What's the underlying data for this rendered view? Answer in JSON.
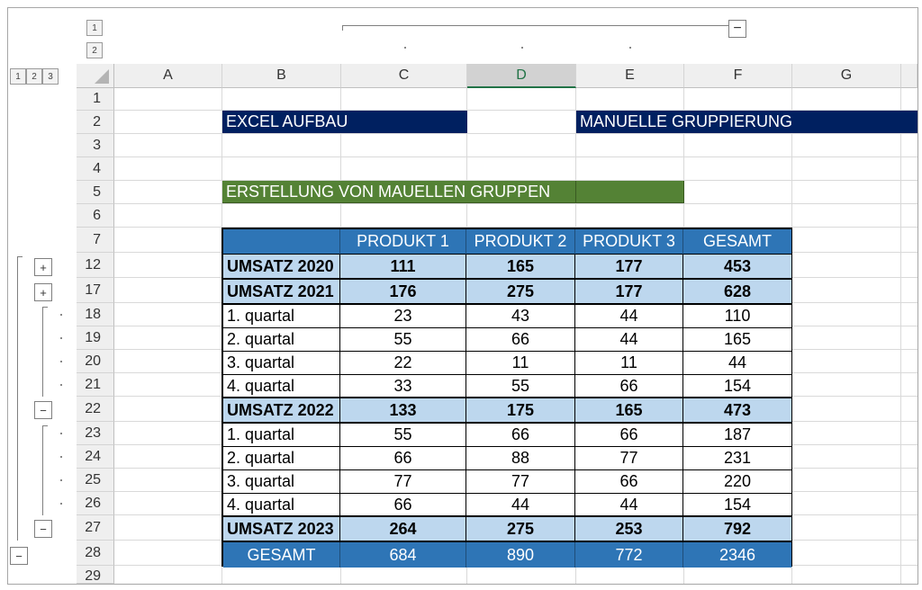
{
  "outline": {
    "col_levels": [
      "1",
      "2"
    ],
    "row_levels": [
      "1",
      "2",
      "3"
    ],
    "buttons": {
      "top_collapse": "−",
      "row12": "+",
      "row17": "+",
      "row22": "−",
      "row27": "−",
      "row28": "−"
    }
  },
  "columns": [
    "A",
    "B",
    "C",
    "D",
    "E",
    "F",
    "G"
  ],
  "selected_column": "D",
  "rows": [
    "1",
    "2",
    "3",
    "4",
    "5",
    "6",
    "7",
    "12",
    "17",
    "18",
    "19",
    "20",
    "21",
    "22",
    "23",
    "24",
    "25",
    "26",
    "27",
    "28",
    "29"
  ],
  "labels": {
    "excel_aufbau": "EXCEL AUFBAU",
    "manuelle": "MANUELLE GRUPPIERUNG",
    "erstellung": "ERSTELLUNG VON MAUELLEN GRUPPEN"
  },
  "table": {
    "headers": [
      "",
      "PRODUKT 1",
      "PRODUKT 2",
      "PRODUKT 3",
      "GESAMT"
    ],
    "rows": [
      {
        "label": "UMSATZ 2020",
        "values": [
          "111",
          "165",
          "177",
          "453"
        ]
      },
      {
        "label": "UMSATZ 2021",
        "values": [
          "176",
          "275",
          "177",
          "628"
        ]
      },
      {
        "label": "1. quartal",
        "values": [
          "23",
          "43",
          "44",
          "110"
        ]
      },
      {
        "label": "2. quartal",
        "values": [
          "55",
          "66",
          "44",
          "165"
        ]
      },
      {
        "label": "3. quartal",
        "values": [
          "22",
          "11",
          "11",
          "44"
        ]
      },
      {
        "label": "4. quartal",
        "values": [
          "33",
          "55",
          "66",
          "154"
        ]
      },
      {
        "label": "UMSATZ 2022",
        "values": [
          "133",
          "175",
          "165",
          "473"
        ]
      },
      {
        "label": "1. quartal",
        "values": [
          "55",
          "66",
          "66",
          "187"
        ]
      },
      {
        "label": "2. quartal",
        "values": [
          "66",
          "88",
          "77",
          "231"
        ]
      },
      {
        "label": "3. quartal",
        "values": [
          "77",
          "77",
          "66",
          "220"
        ]
      },
      {
        "label": "4. quartal",
        "values": [
          "66",
          "44",
          "44",
          "154"
        ]
      },
      {
        "label": "UMSATZ 2023",
        "values": [
          "264",
          "275",
          "253",
          "792"
        ]
      },
      {
        "label": "GESAMT",
        "values": [
          "684",
          "890",
          "772",
          "2346"
        ]
      }
    ]
  },
  "colors": {
    "navy": "#002060",
    "green": "#548235",
    "header_blue": "#2e75b6",
    "light_blue": "#bdd7ee",
    "selected_col_accent": "#217346"
  }
}
